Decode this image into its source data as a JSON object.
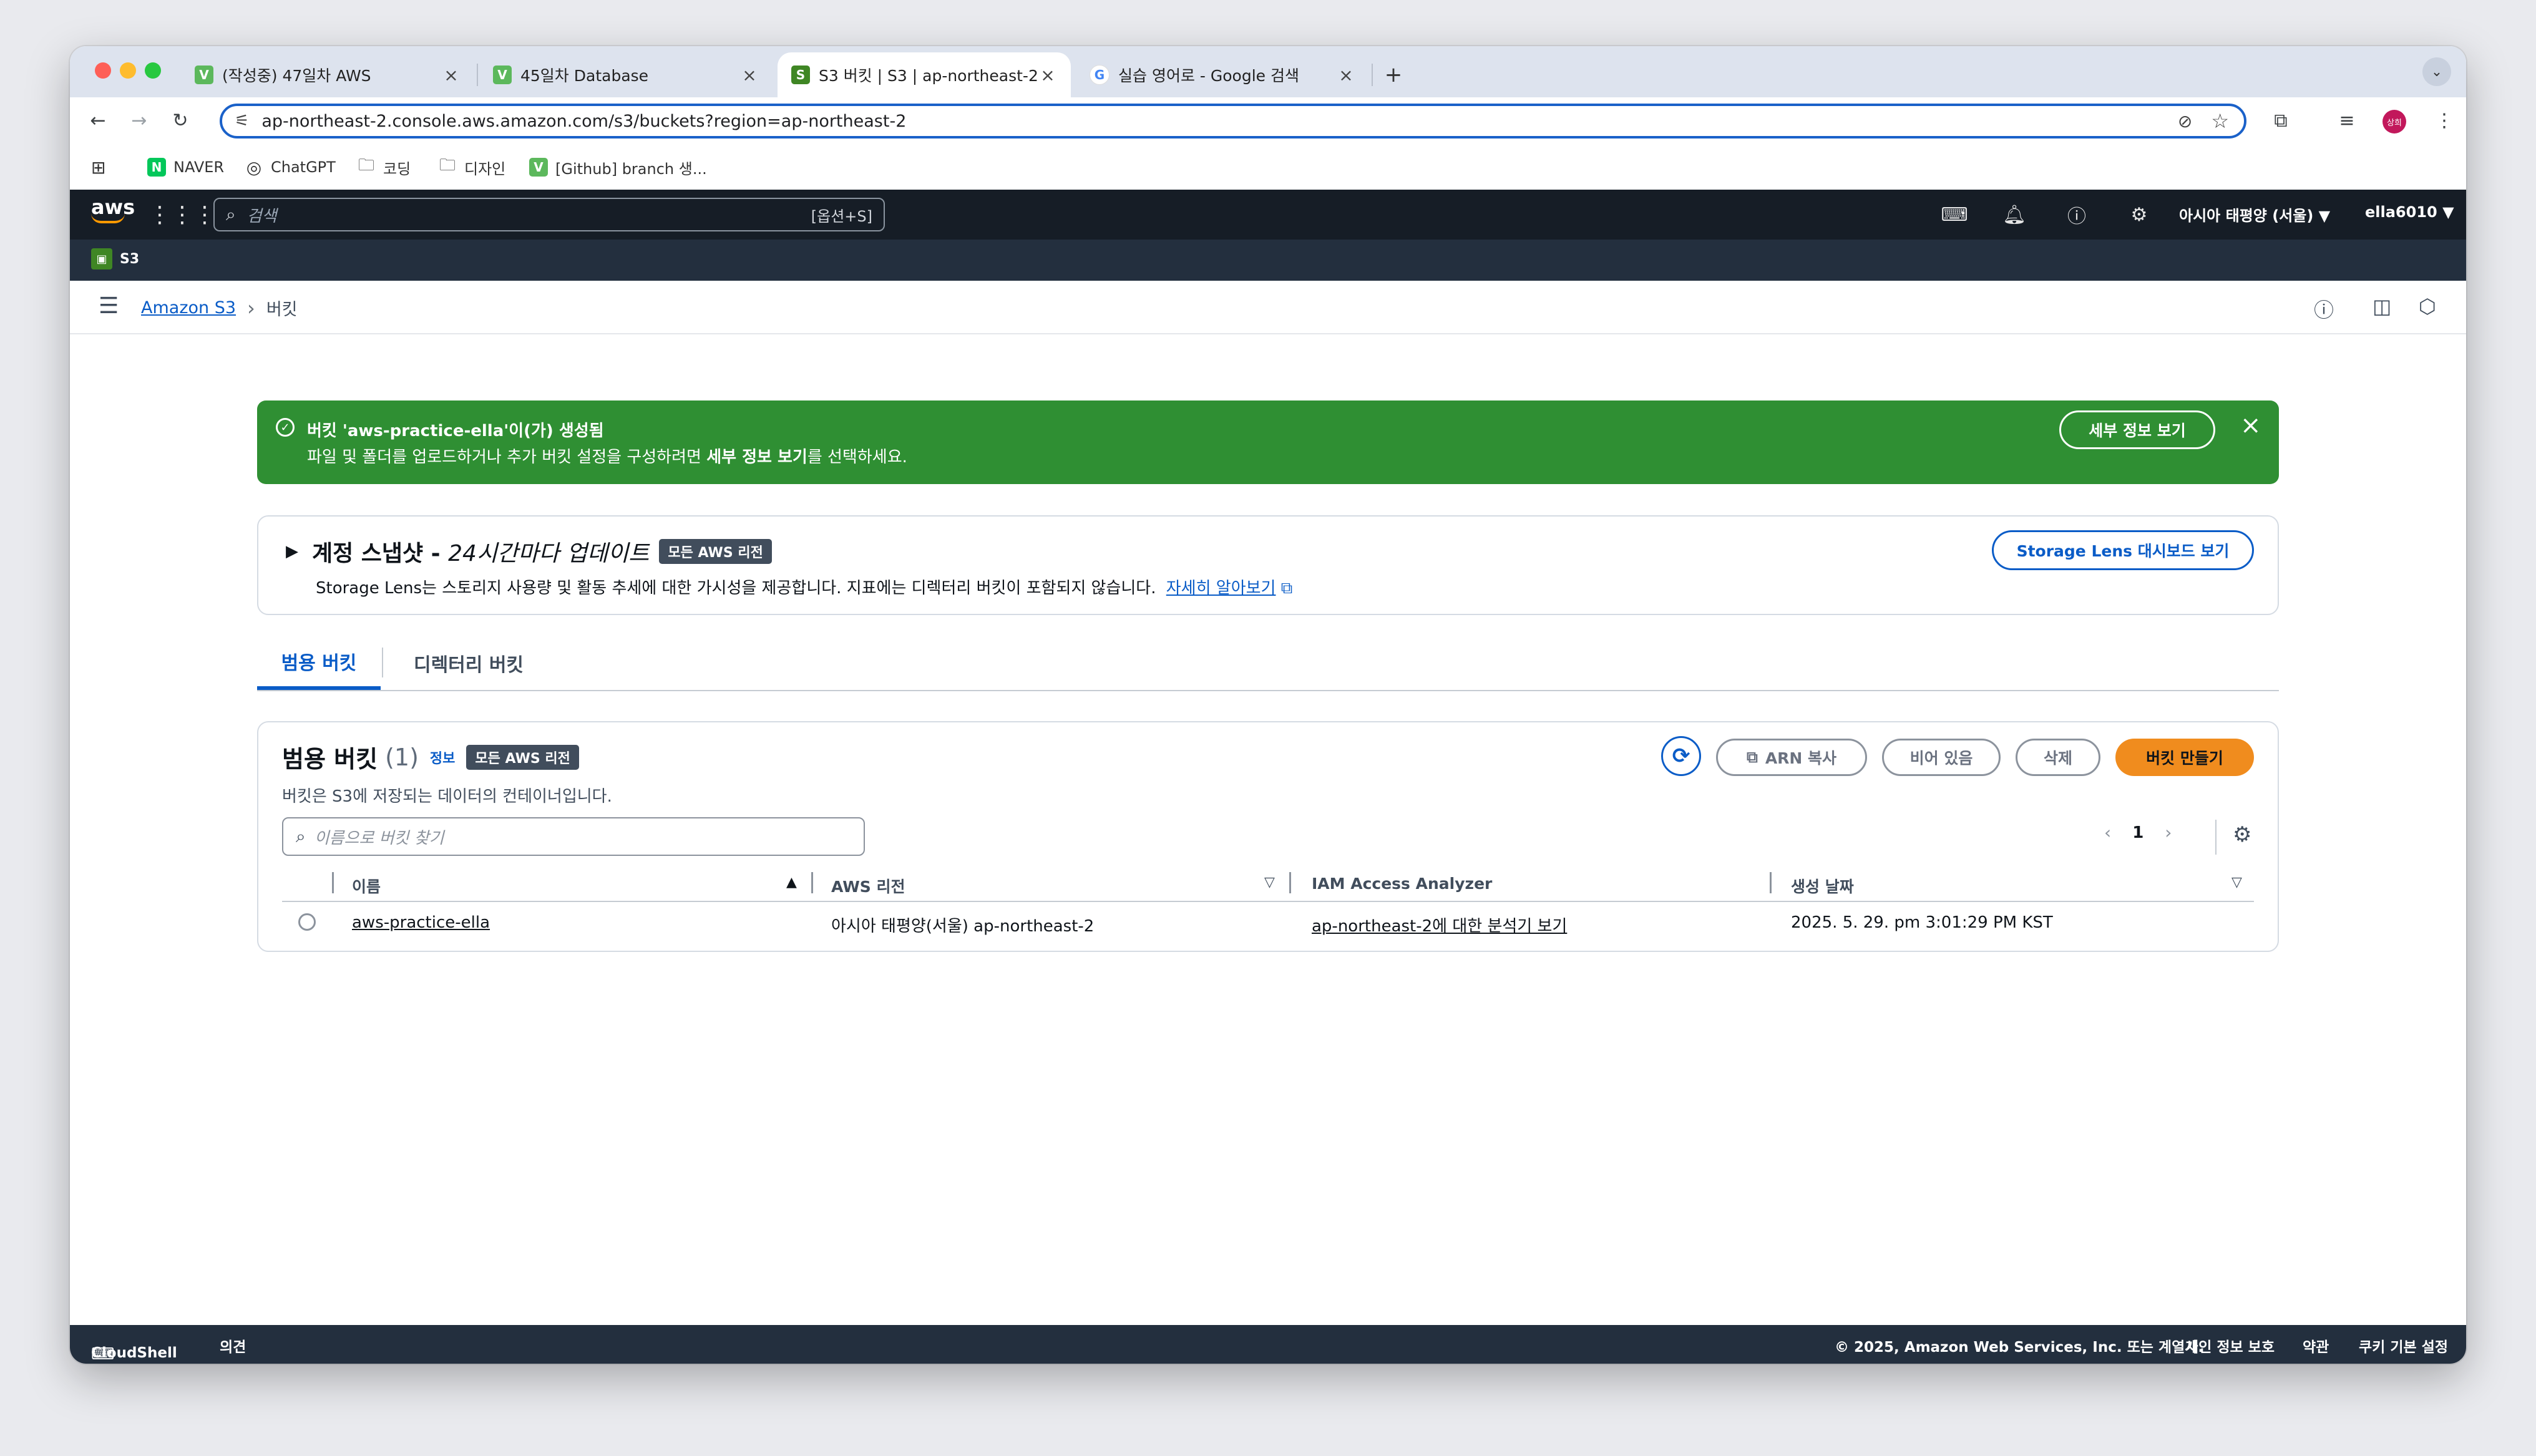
{
  "browser": {
    "tabs": [
      {
        "title": "(작성중) 47일차 AWS",
        "favicon_letter": "V",
        "favicon_color": "#5cb85c"
      },
      {
        "title": "45일차 Database",
        "favicon_letter": "V",
        "favicon_color": "#5cb85c"
      },
      {
        "title": "S3 버킷 | S3 | ap-northeast-2",
        "favicon_letter": "S",
        "favicon_color": "#3f8624"
      },
      {
        "title": "실습 영어로 - Google 검색",
        "favicon_letter": "G",
        "favicon_color": "#4285f4"
      }
    ],
    "new_tab": "+",
    "url": "ap-northeast-2.console.aws.amazon.com/s3/buckets?region=ap-northeast-2",
    "profile_initials": "상희",
    "bookmarks": [
      {
        "label": "NAVER",
        "icon": "naver-icon"
      },
      {
        "label": "ChatGPT",
        "icon": "chatgpt-icon"
      },
      {
        "label": "코딩",
        "icon": "folder-icon"
      },
      {
        "label": "디자인",
        "icon": "folder-icon"
      },
      {
        "label": "[Github] branch 생...",
        "icon": "bookmark-v-icon"
      }
    ]
  },
  "aws_header": {
    "logo": "aws",
    "search_placeholder": "검색",
    "search_shortcut": "[옵션+S]",
    "region": "아시아 태평양 (서울) ▼",
    "account": "ella6010 ▼",
    "service": "S3"
  },
  "breadcrumb": {
    "root": "Amazon S3",
    "separator": "›",
    "current": "버킷"
  },
  "flash": {
    "title": "버킷 'aws-practice-ella'이(가) 생성됨",
    "message_pre": "파일 및 폴더를 업로드하거나 추가 버킷 설정을 구성하려면 ",
    "message_bold": "세부 정보 보기",
    "message_post": "를 선택하세요.",
    "button": "세부 정보 보기",
    "color": "#2f8f33"
  },
  "snapshot": {
    "caret": "▶",
    "title_bold": "계정 스냅샷 - ",
    "title_italic": "24시간마다 업데이트",
    "badge": "모든 AWS 리전",
    "description": "Storage Lens는 스토리지 사용량 및 활동 추세에 대한 가시성을 제공합니다. 지표에는 디렉터리 버킷이 포함되지 않습니다.",
    "learn_more": "자세히 알아보기",
    "button": "Storage Lens 대시보드 보기"
  },
  "tabs": [
    {
      "label": "범용 버킷",
      "active": true
    },
    {
      "label": "디렉터리 버킷",
      "active": false
    }
  ],
  "buckets_panel": {
    "title": "범용 버킷",
    "count": "(1)",
    "info": "정보",
    "badge": "모든 AWS 리전",
    "description": "버킷은 S3에 저장되는 데이터의 컨테이너입니다.",
    "search_placeholder": "이름으로 버킷 찾기",
    "buttons": {
      "copy_arn": "ARN 복사",
      "empty": "비어 있음",
      "delete": "삭제",
      "create": "버킷 만들기"
    },
    "page": "1",
    "columns": [
      "이름",
      "AWS 리전",
      "IAM Access Analyzer",
      "생성 날짜"
    ],
    "rows": [
      {
        "name": "aws-practice-ella",
        "region": "아시아 태평양(서울) ap-northeast-2",
        "analyzer": "ap-northeast-2에 대한 분석기 보기",
        "created": "2025. 5. 29. pm 3:01:29 PM KST"
      }
    ]
  },
  "footer": {
    "cloudshell": "CloudShell",
    "feedback": "의견",
    "copyright": "© 2025, Amazon Web Services, Inc. 또는 계열사.",
    "privacy": "개인 정보 보호",
    "terms": "약관",
    "cookies": "쿠키 기본 설정"
  }
}
